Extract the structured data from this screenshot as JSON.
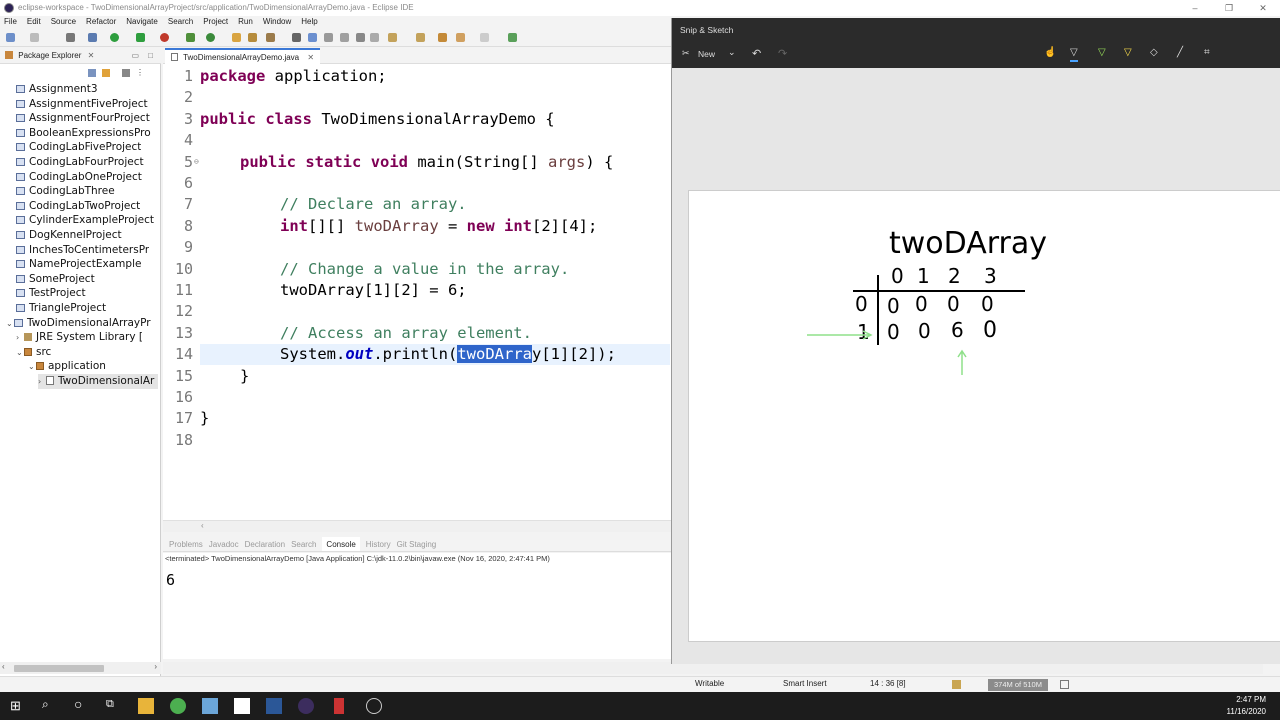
{
  "window": {
    "title": "eclipse-workspace - TwoDimensionalArrayProject/src/application/TwoDimensionalArrayDemo.java - Eclipse IDE"
  },
  "menu": [
    "File",
    "Edit",
    "Source",
    "Refactor",
    "Navigate",
    "Search",
    "Project",
    "Run",
    "Window",
    "Help"
  ],
  "package_explorer": {
    "title": "Package Explorer",
    "items": [
      {
        "label": "Assignment3",
        "type": "project"
      },
      {
        "label": "AssignmentFiveProject",
        "type": "project"
      },
      {
        "label": "AssignmentFourProject",
        "type": "project"
      },
      {
        "label": "BooleanExpressionsPro",
        "type": "project"
      },
      {
        "label": "CodingLabFiveProject",
        "type": "project"
      },
      {
        "label": "CodingLabFourProject",
        "type": "project"
      },
      {
        "label": "CodingLabOneProject",
        "type": "project"
      },
      {
        "label": "CodingLabThree",
        "type": "project"
      },
      {
        "label": "CodingLabTwoProject",
        "type": "project"
      },
      {
        "label": "CylinderExampleProject",
        "type": "project"
      },
      {
        "label": "DogKennelProject",
        "type": "project"
      },
      {
        "label": "InchesToCentimetersPr",
        "type": "project"
      },
      {
        "label": "NameProjectExample",
        "type": "project"
      },
      {
        "label": "SomeProject",
        "type": "project"
      },
      {
        "label": "TestProject",
        "type": "project"
      },
      {
        "label": "TriangleProject",
        "type": "project"
      },
      {
        "label": "TwoDimensionalArrayPr",
        "type": "project-open"
      },
      {
        "label": "JRE System Library [",
        "type": "jar"
      },
      {
        "label": "src",
        "type": "folder"
      },
      {
        "label": "application",
        "type": "package"
      },
      {
        "label": "TwoDimensionalAr",
        "type": "java"
      }
    ]
  },
  "editor": {
    "tab": "TwoDimensionalArrayDemo.java",
    "line_numbers": [
      "1",
      "2",
      "3",
      "4",
      "5",
      "6",
      "7",
      "8",
      "9",
      "10",
      "11",
      "12",
      "13",
      "14",
      "15",
      "16",
      "17",
      "18"
    ],
    "lines": {
      "l1_kw": "package",
      "l1_rest": " application;",
      "l3_kw1": "public",
      "l3_kw2": "class",
      "l3_rest": " TwoDimensionalArrayDemo {",
      "l5_kw1": "public",
      "l5_kw2": "static",
      "l5_kw3": "void",
      "l5_rest": " main(String[] ",
      "l5_var": "args",
      "l5_end": ") {",
      "l7": "// Declare an array.",
      "l8_kw": "int",
      "l8_a": "[][] ",
      "l8_var": "twoDArray",
      "l8_b": " = ",
      "l8_kw2": "new",
      "l8_kw3": "int",
      "l8_c": "[2][4];",
      "l10": "// Change a value in the array.",
      "l11": "twoDArray[1][2] = 6;",
      "l13": "// Access an array element.",
      "l14_a": "System.",
      "l14_field": "out",
      "l14_b": ".println(",
      "l14_sel": "twoDArra",
      "l14_c": "y[1][2]);",
      "l15": "}",
      "l17": "}"
    }
  },
  "console": {
    "tabs": [
      "Problems",
      "Javadoc",
      "Declaration",
      "Search",
      "Console",
      "History",
      "Git Staging"
    ],
    "header": "<terminated> TwoDimensionalArrayDemo [Java Application] C:\\jdk-11.0.2\\bin\\javaw.exe (Nov 16, 2020, 2:47:41 PM)",
    "output": "6"
  },
  "status": {
    "writable": "Writable",
    "insert": "Smart Insert",
    "position": "14 : 36 [8]",
    "heap": "374M of 510M"
  },
  "snip": {
    "title": "Snip & Sketch",
    "new_label": "New",
    "drawing": {
      "title": "twoDArray",
      "col_headers": [
        "0",
        "1",
        "2",
        "3"
      ],
      "rows": [
        {
          "label": "0",
          "values": [
            "0",
            "0",
            "0",
            "0"
          ]
        },
        {
          "label": "1",
          "values": [
            "0",
            "0",
            "6",
            "0"
          ]
        }
      ]
    }
  },
  "taskbar": {
    "time": "2:47 PM",
    "date": "11/16/2020"
  }
}
